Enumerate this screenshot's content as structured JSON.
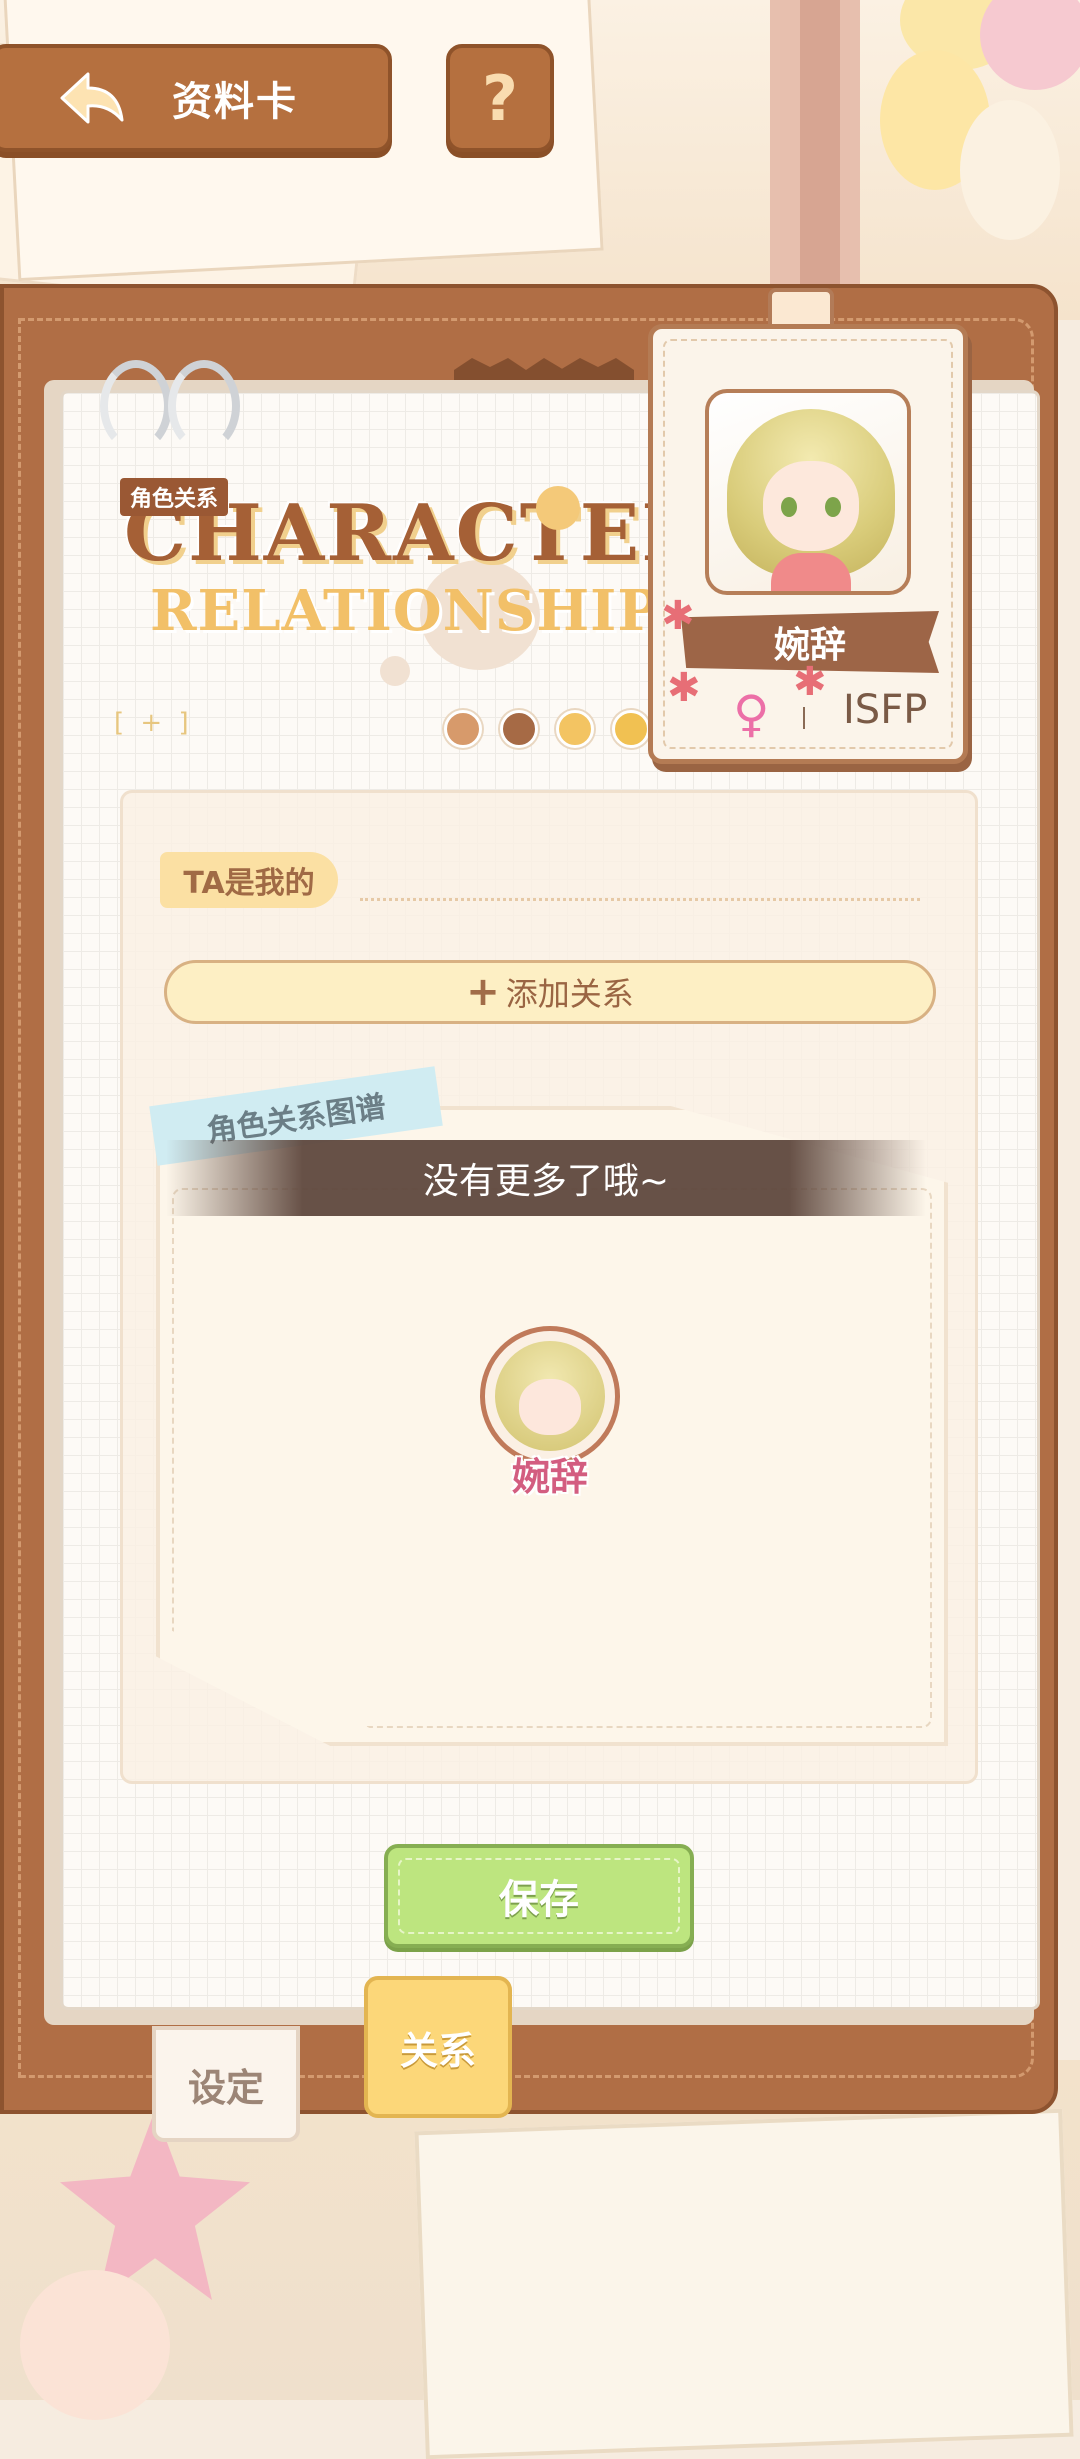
{
  "header": {
    "back_label": "资料卡",
    "help_label": "?"
  },
  "title": {
    "tag": "角色关系",
    "line1": "CHARACTER",
    "line2": "RELATIONSHIPS",
    "bracket": "[ + ]"
  },
  "id_card": {
    "name": "婉辞",
    "gender_symbol": "♀",
    "mbti": "ISFP"
  },
  "form": {
    "ta_label": "TA是我的",
    "add_relation_label": "添加关系",
    "add_relation_icon": "+"
  },
  "graph": {
    "tag": "角色关系图谱",
    "toast": "没有更多了哦~",
    "center_name": "婉辞"
  },
  "actions": {
    "save_label": "保存"
  },
  "tabs": [
    {
      "label": "设定",
      "active": false
    },
    {
      "label": "关系",
      "active": true
    }
  ],
  "colors": {
    "brown_button": "#b5703f",
    "save_green": "#bde57f",
    "active_tab": "#fcd779",
    "name_pink": "#d35d80"
  }
}
